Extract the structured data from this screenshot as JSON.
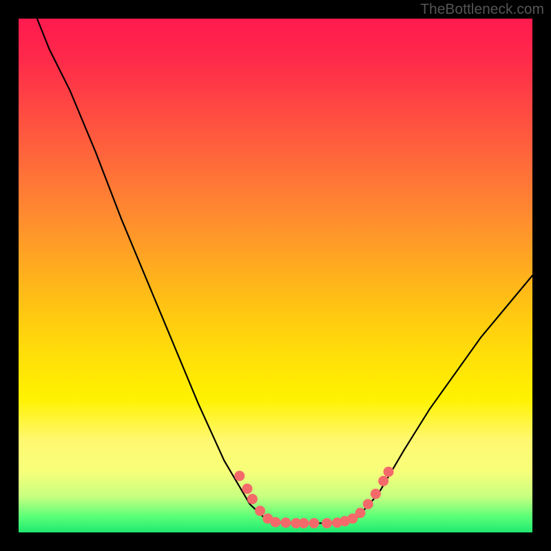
{
  "attribution": "TheBottleneck.com",
  "chart_data": {
    "type": "line",
    "title": "",
    "xlabel": "",
    "ylabel": "",
    "xlim": [
      0,
      100
    ],
    "ylim": [
      0,
      100
    ],
    "curve": [
      {
        "x": 3.6,
        "y": 100
      },
      {
        "x": 6,
        "y": 94
      },
      {
        "x": 10,
        "y": 86
      },
      {
        "x": 15,
        "y": 74
      },
      {
        "x": 20,
        "y": 61
      },
      {
        "x": 25,
        "y": 49
      },
      {
        "x": 30,
        "y": 37
      },
      {
        "x": 35,
        "y": 25
      },
      {
        "x": 40,
        "y": 14
      },
      {
        "x": 45,
        "y": 5.5
      },
      {
        "x": 48.5,
        "y": 2.2
      },
      {
        "x": 50,
        "y": 2.0
      },
      {
        "x": 55,
        "y": 1.8
      },
      {
        "x": 60,
        "y": 1.8
      },
      {
        "x": 63,
        "y": 2.0
      },
      {
        "x": 66,
        "y": 3.0
      },
      {
        "x": 70,
        "y": 7.5
      },
      {
        "x": 75,
        "y": 16
      },
      {
        "x": 80,
        "y": 24
      },
      {
        "x": 85,
        "y": 31
      },
      {
        "x": 90,
        "y": 38
      },
      {
        "x": 95,
        "y": 44
      },
      {
        "x": 100,
        "y": 50
      }
    ],
    "markers": [
      {
        "x": 43.0,
        "y": 11.0
      },
      {
        "x": 44.5,
        "y": 8.5
      },
      {
        "x": 45.5,
        "y": 6.5
      },
      {
        "x": 47.0,
        "y": 4.2
      },
      {
        "x": 48.5,
        "y": 2.7
      },
      {
        "x": 50.0,
        "y": 2.0
      },
      {
        "x": 52.0,
        "y": 1.9
      },
      {
        "x": 54.0,
        "y": 1.8
      },
      {
        "x": 55.5,
        "y": 1.8
      },
      {
        "x": 57.5,
        "y": 1.8
      },
      {
        "x": 60.0,
        "y": 1.8
      },
      {
        "x": 62.0,
        "y": 1.9
      },
      {
        "x": 63.5,
        "y": 2.2
      },
      {
        "x": 65.0,
        "y": 2.7
      },
      {
        "x": 66.5,
        "y": 3.8
      },
      {
        "x": 68.0,
        "y": 5.5
      },
      {
        "x": 69.5,
        "y": 7.5
      },
      {
        "x": 71.0,
        "y": 10.0
      },
      {
        "x": 72.0,
        "y": 11.8
      }
    ],
    "colors": {
      "curve": "#000000",
      "marker": "#f46a6a",
      "gradient_top": "#ff1a4e",
      "gradient_bottom": "#20e870"
    }
  }
}
